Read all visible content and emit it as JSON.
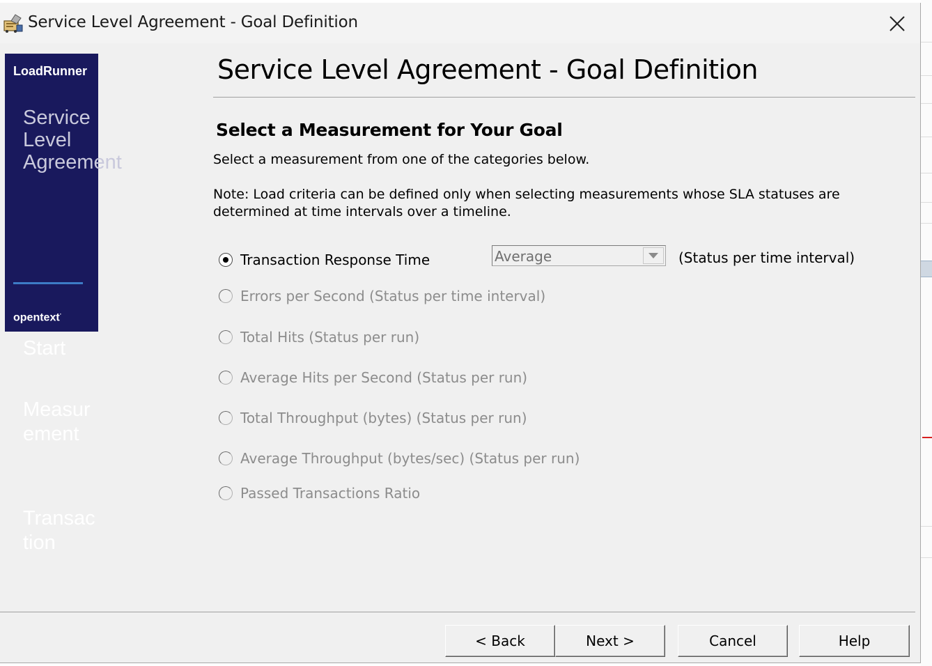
{
  "window": {
    "title": "Service Level Agreement - Goal Definition",
    "close_icon": "close-icon",
    "app_icon": "sla-wizard-icon"
  },
  "banner": {
    "brand": "LoadRunner",
    "stage_title": "Service Level Agreement",
    "company": "opentext",
    "background_color": "#19195d",
    "steps": [
      "Start",
      "Measurement",
      "Transaction"
    ]
  },
  "page": {
    "heading": "Service Level Agreement - Goal Definition",
    "subheading": "Select a Measurement for Your Goal",
    "description": "Select a measurement from one of the categories below.",
    "note": "Note: Load criteria can be defined only when selecting measurements whose SLA statuses are determined at time intervals over a timeline."
  },
  "measurements": [
    {
      "label": "Transaction Response Time",
      "checked": true,
      "enabled": true
    },
    {
      "label": "Errors per Second (Status per time interval)",
      "checked": false,
      "enabled": false
    },
    {
      "label": "Total Hits (Status per run)",
      "checked": false,
      "enabled": false
    },
    {
      "label": "Average Hits per Second (Status per run)",
      "checked": false,
      "enabled": false
    },
    {
      "label": "Total Throughput (bytes) (Status per run)",
      "checked": false,
      "enabled": false
    },
    {
      "label": "Average Throughput (bytes/sec) (Status per run)",
      "checked": false,
      "enabled": false
    },
    {
      "label": "Passed Transactions Ratio",
      "checked": false,
      "enabled": false
    }
  ],
  "trt_dropdown": {
    "selected": "Average",
    "status_note": "(Status per time interval)"
  },
  "buttons": {
    "back": "< Back",
    "next": "Next >",
    "cancel": "Cancel",
    "help": "Help"
  }
}
